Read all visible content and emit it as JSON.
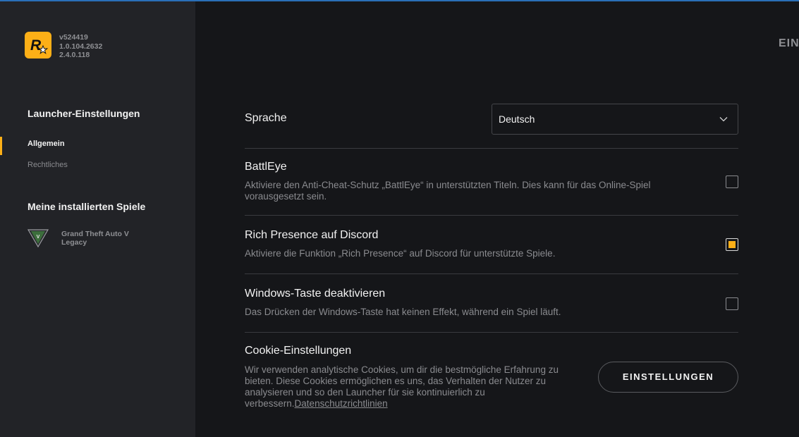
{
  "app": {
    "versions": [
      "v524419",
      "1.0.104.2632",
      "2.4.0.118"
    ],
    "corner_label": "EIN",
    "accent_color": "#fcaf17"
  },
  "sidebar": {
    "launcher_section_title": "Launcher-Einstellungen",
    "launcher_items": [
      {
        "label": "Allgemein",
        "active": true
      },
      {
        "label": "Rechtliches",
        "active": false
      }
    ],
    "games_section_title": "Meine installierten Spiele",
    "games": [
      {
        "title_line1": "Grand Theft Auto V",
        "title_line2": "Legacy",
        "icon": "gta-v-logo-icon"
      }
    ]
  },
  "settings": {
    "language": {
      "title": "Sprache",
      "selected": "Deutsch"
    },
    "battleye": {
      "title": "BattlEye",
      "description_line1": "Aktiviere den Anti-Cheat-Schutz „BattlEye“ in unterstützten Titeln. Dies kann für das Online-Spiel",
      "description_line2": "vorausgesetzt sein.",
      "checked": false
    },
    "discord": {
      "title": "Rich Presence auf Discord",
      "description": "Aktiviere die Funktion „Rich Presence“ auf Discord für unterstützte Spiele.",
      "checked": true
    },
    "windows_key": {
      "title": "Windows-Taste deaktivieren",
      "description": "Das Drücken der Windows-Taste hat keinen Effekt, während ein Spiel läuft.",
      "checked": false
    },
    "cookies": {
      "title": "Cookie-Einstellungen",
      "description_line1": "Wir verwenden analytische Cookies, um dir die bestmögliche Erfahrung zu",
      "description_line2": "bieten. Diese Cookies ermöglichen es uns, das Verhalten der Nutzer zu",
      "description_line3": "analysieren und so den Launcher für sie kontinuierlich zu",
      "description_line4": "verbessern.",
      "privacy_link": "Datenschutzrichtlinien",
      "button_label": "EINSTELLUNGEN"
    }
  }
}
